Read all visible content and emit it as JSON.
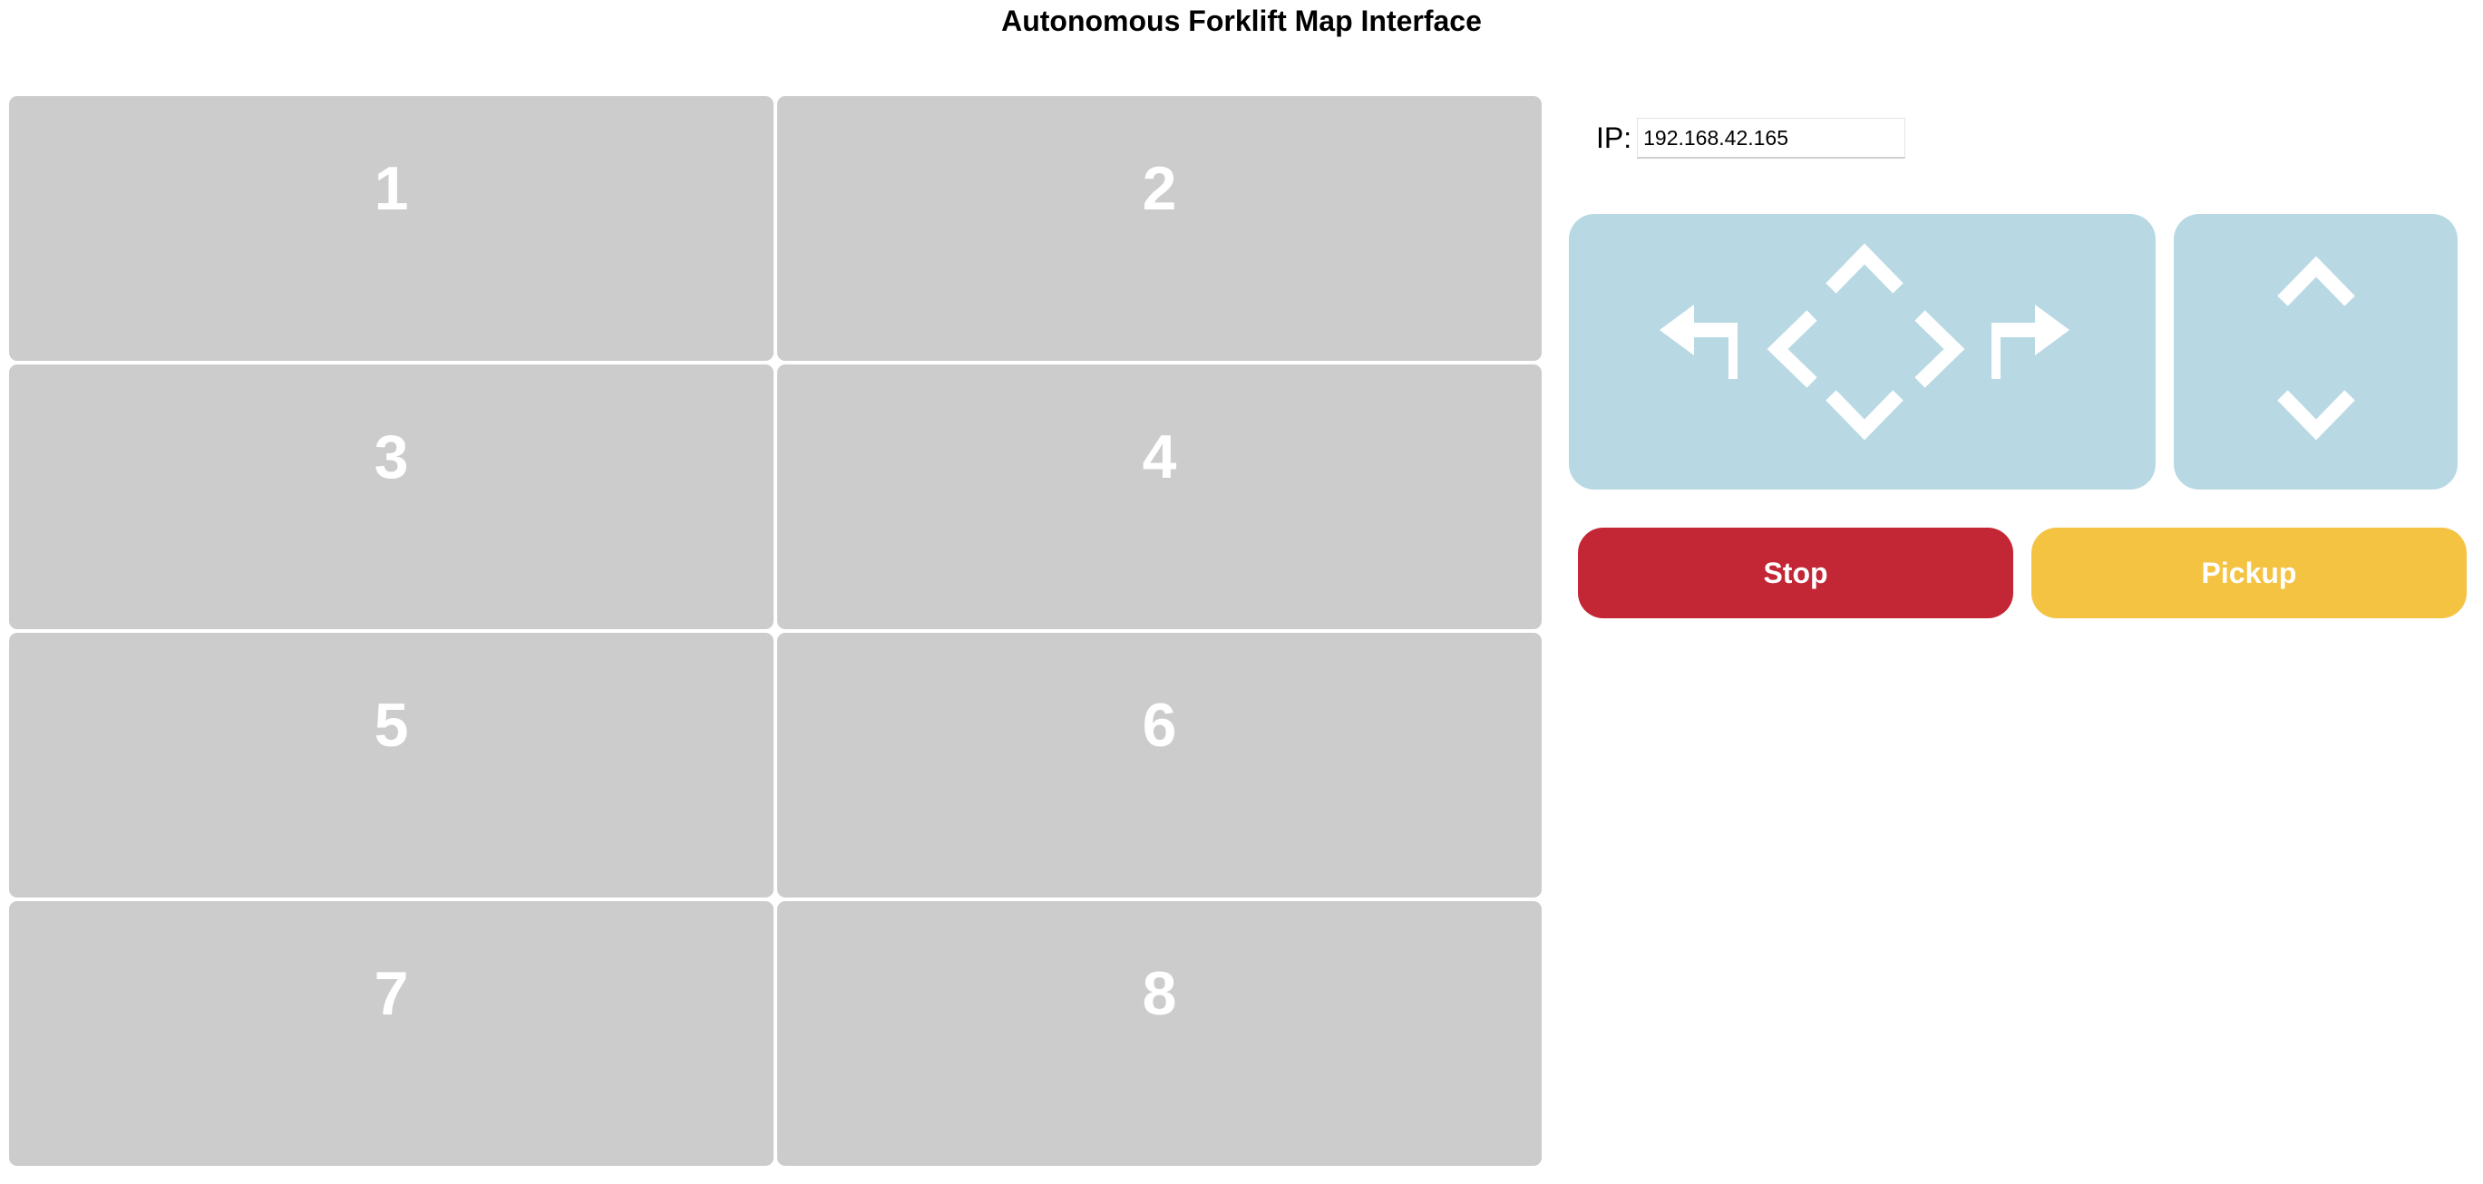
{
  "header": {
    "title": "Autonomous Forklift Map Interface"
  },
  "map": {
    "zones": [
      {
        "label": "1"
      },
      {
        "label": "2"
      },
      {
        "label": "3"
      },
      {
        "label": "4"
      },
      {
        "label": "5"
      },
      {
        "label": "6"
      },
      {
        "label": "7"
      },
      {
        "label": "8"
      }
    ],
    "zone_color": "#cccccc"
  },
  "connection": {
    "ip_label": "IP:",
    "ip_value": "192.168.42.165"
  },
  "controls": {
    "movement_pad": {
      "color": "#b8d9e3",
      "icons": [
        "turn-left-icon",
        "chevron-left-icon",
        "chevron-up-icon",
        "chevron-down-icon",
        "chevron-right-icon",
        "turn-right-icon"
      ]
    },
    "lift_pad": {
      "color": "#b8d9e3",
      "icons": [
        "chevron-up-icon",
        "chevron-down-icon"
      ]
    }
  },
  "actions": {
    "stop_label": "Stop",
    "stop_color": "#c32634",
    "pickup_label": "Pickup",
    "pickup_color": "#f4c342"
  }
}
